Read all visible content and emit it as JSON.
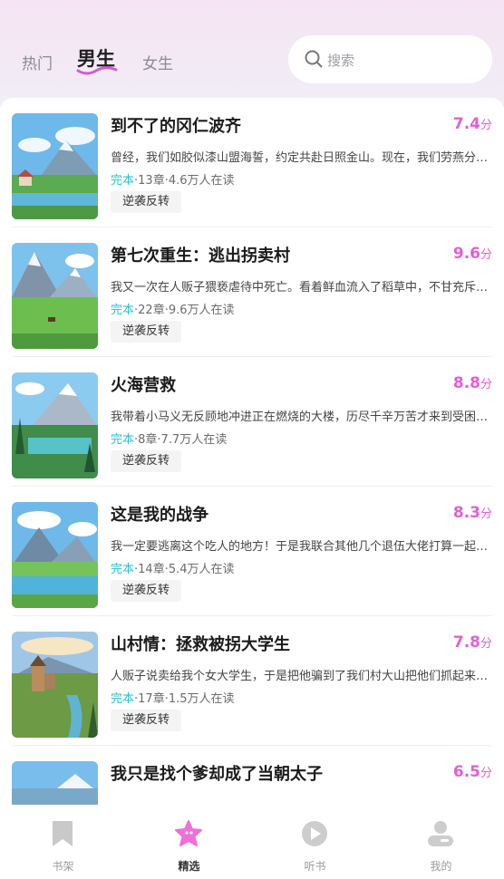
{
  "header": {
    "tabs": [
      {
        "label": "热门"
      },
      {
        "label": "男生"
      },
      {
        "label": "女生"
      }
    ],
    "active_tab": 1,
    "search": {
      "placeholder": "搜索",
      "icon": "search-icon"
    },
    "accent_color": "#d55bd0"
  },
  "books": [
    {
      "title": "到不了的冈仁波齐",
      "score": "7.4",
      "score_unit": "分",
      "desc": "曾经，我们如胶似漆山盟海誓，约定共赴日照金山。现在，我们劳燕分飞……",
      "status": "完本",
      "info": "·13章·4.6万人在读",
      "tag": "逆袭反转"
    },
    {
      "title": "第七次重生：逃出拐卖村",
      "score": "9.6",
      "score_unit": "分",
      "desc": "我又一次在人贩子猥亵虐待中死亡。看着鲜血流入了稻草中，不甘充斥着……",
      "status": "完本",
      "info": "·22章·9.6万人在读",
      "tag": "逆袭反转"
    },
    {
      "title": "火海营救",
      "score": "8.8",
      "score_unit": "分",
      "desc": "我带着小马义无反顾地冲进正在燃烧的大楼，历尽千辛万苦才来到受困者……",
      "status": "完本",
      "info": "·8章·7.7万人在读",
      "tag": "逆袭反转"
    },
    {
      "title": "这是我的战争",
      "score": "8.3",
      "score_unit": "分",
      "desc": "我一定要逃离这个吃人的地方！于是我联合其他几个退伍大佬打算一起……",
      "status": "完本",
      "info": "·14章·5.4万人在读",
      "tag": "逆袭反转"
    },
    {
      "title": "山村情：拯救被拐大学生",
      "score": "7.8",
      "score_unit": "分",
      "desc": "人贩子说卖给我个女大学生，于是把他骗到了我们村大山把他们抓起来……",
      "status": "完本",
      "info": "·17章·1.5万人在读",
      "tag": "逆袭反转"
    },
    {
      "title": "我只是找个爹却成了当朝太子",
      "score": "6.5",
      "score_unit": "分",
      "desc": "",
      "status": "",
      "info": "",
      "tag": ""
    }
  ],
  "tabbar": {
    "items": [
      {
        "label": "书架",
        "icon": "bookmark-icon"
      },
      {
        "label": "精选",
        "icon": "star-icon"
      },
      {
        "label": "听书",
        "icon": "play-icon"
      },
      {
        "label": "我的",
        "icon": "user-icon"
      }
    ],
    "active": 1
  },
  "colors": {
    "score": "#e25fd6",
    "status": "#27c0d0",
    "tab_active_star": "#f06fd9"
  }
}
